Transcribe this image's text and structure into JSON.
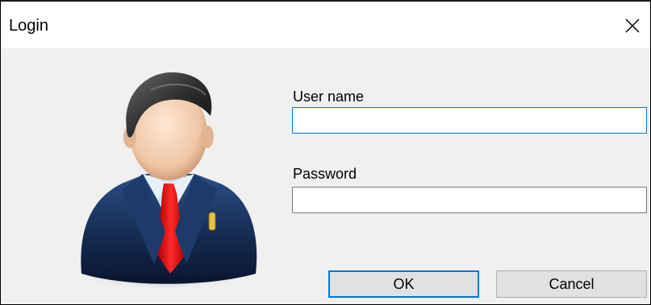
{
  "window": {
    "title": "Login"
  },
  "form": {
    "username_label": "User name",
    "username_value": "",
    "password_label": "Password",
    "password_value": ""
  },
  "buttons": {
    "ok_label": "OK",
    "cancel_label": "Cancel"
  },
  "icons": {
    "close": "close-icon",
    "avatar": "user-avatar-icon"
  },
  "colors": {
    "focus_accent": "#0078d7",
    "dialog_background": "#f0f0f0",
    "title_background": "#ffffff"
  }
}
